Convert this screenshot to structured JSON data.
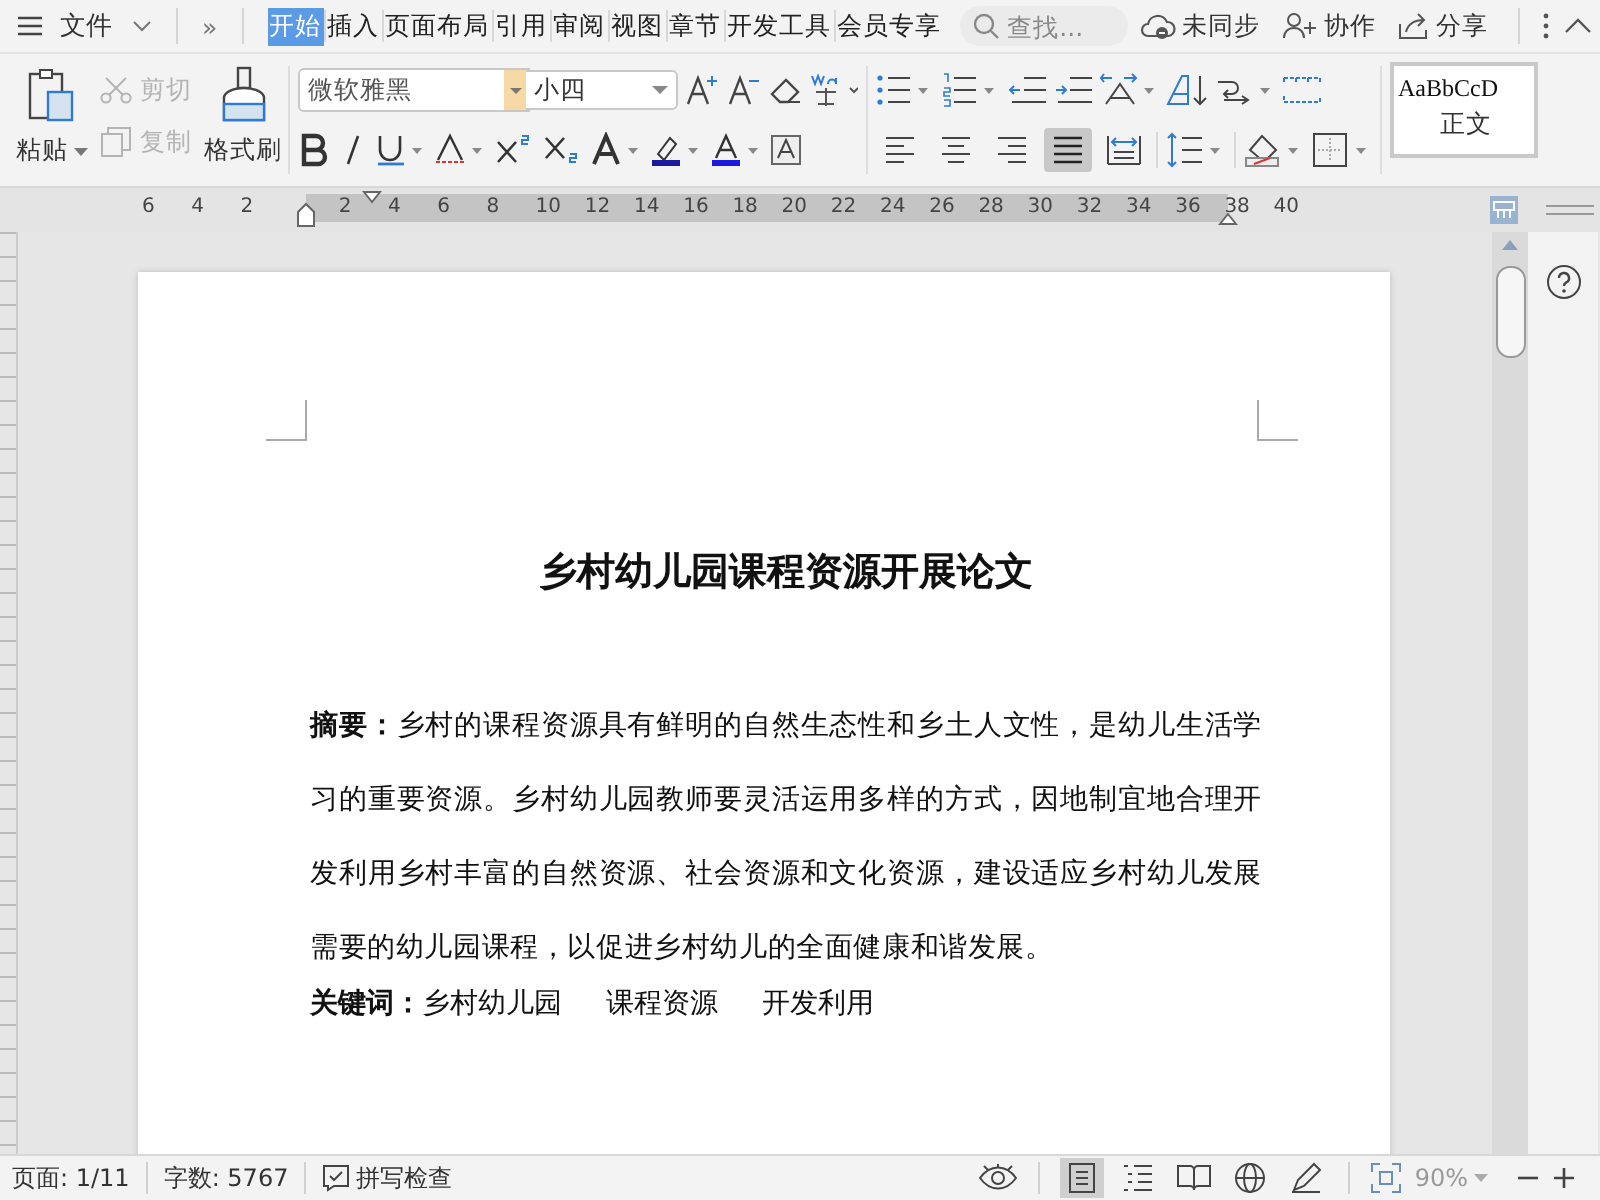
{
  "menubar": {
    "file_menu": "文件",
    "more": "»",
    "tabs": [
      {
        "label": "开始",
        "selected": true
      },
      {
        "label": "插入",
        "selected": false
      },
      {
        "label": "页面布局",
        "selected": false
      },
      {
        "label": "引用",
        "selected": false
      },
      {
        "label": "审阅",
        "selected": false
      },
      {
        "label": "视图",
        "selected": false
      },
      {
        "label": "章节",
        "selected": false
      },
      {
        "label": "开发工具",
        "selected": false
      },
      {
        "label": "会员专享",
        "selected": false
      }
    ],
    "search": {
      "placeholder": "查找..."
    },
    "actions": [
      {
        "kind": "cloud",
        "label": "未同步"
      },
      {
        "kind": "person",
        "label": "协作"
      },
      {
        "kind": "share",
        "label": "分享"
      }
    ]
  },
  "toolbar": {
    "paste": "粘贴",
    "cut": {
      "label": "剪切",
      "disabled": true
    },
    "copy": {
      "label": "复制",
      "disabled": true
    },
    "format_painter": "格式刷",
    "font": {
      "value": "微软雅黑"
    },
    "size": {
      "value": "小四"
    },
    "align_buttons": [
      {
        "kind": "left",
        "selected": false
      },
      {
        "kind": "center",
        "selected": false
      },
      {
        "kind": "right",
        "selected": false
      },
      {
        "kind": "justify",
        "selected": true
      },
      {
        "kind": "distributed",
        "selected": false
      }
    ],
    "style_gallery": {
      "sample": "AaBbCcD",
      "name": "正文"
    }
  },
  "ruler": {
    "labels": [
      "6",
      "4",
      "2",
      "2",
      "4",
      "6",
      "8",
      "10",
      "12",
      "14",
      "16",
      "18",
      "20",
      "22",
      "24",
      "26",
      "28",
      "30",
      "32",
      "34",
      "36",
      "38",
      "40"
    ]
  },
  "document": {
    "title": "乡村幼儿园课程资源开展论文",
    "abstract": "**摘要：**乡村的课程资源具有鲜明的自然生态性和乡土人文性，是幼儿生活学习的重要资源。乡村幼儿园教师要灵活运用多样的方式，因地制宜地合理开发利用乡村丰富的自然资源、社会资源和文化资源，建设适应乡村幼儿发展需要的幼儿园课程，以促进乡村幼儿的全面健康和谐发展。",
    "keywords_label": "关键词：",
    "keywords": [
      "乡村幼儿园",
      "课程资源",
      "开发利用"
    ]
  },
  "status_bar": {
    "page": "页面: 1/11",
    "words": "字数: 5767",
    "spell_check": "拼写检查",
    "view_buttons": [
      {
        "kind": "page",
        "selected": true
      },
      {
        "kind": "outline",
        "selected": false
      },
      {
        "kind": "reading",
        "selected": false
      },
      {
        "kind": "web",
        "selected": false
      },
      {
        "kind": "write",
        "selected": false
      }
    ],
    "zoom": "90%"
  }
}
